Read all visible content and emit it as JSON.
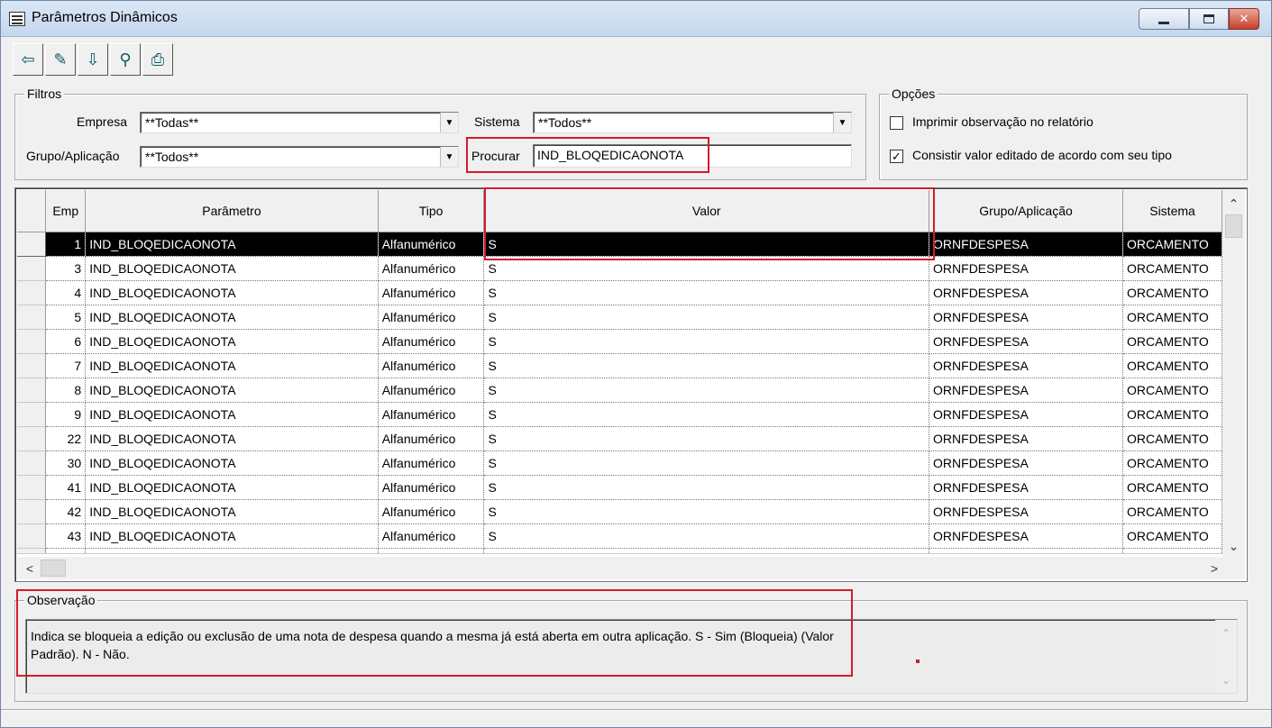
{
  "window": {
    "title": "Parâmetros Dinâmicos"
  },
  "toolbar": {
    "buttons": [
      {
        "name": "exit-icon",
        "glyph": "⇦"
      },
      {
        "name": "edit-icon",
        "glyph": "✎"
      },
      {
        "name": "import-icon",
        "glyph": "⇩"
      },
      {
        "name": "binoculars-icon",
        "glyph": "⚲"
      },
      {
        "name": "printer-icon",
        "glyph": "⎙"
      }
    ]
  },
  "filtros": {
    "legend": "Filtros",
    "empresa_label": "Empresa",
    "empresa_value": "**Todas**",
    "grupo_label": "Grupo/Aplicação",
    "grupo_value": "**Todos**",
    "sistema_label": "Sistema",
    "sistema_value": "**Todos**",
    "procurar_label": "Procurar",
    "procurar_value": "IND_BLOQEDICAONOTA"
  },
  "opcoes": {
    "legend": "Opções",
    "opt1_label": "Imprimir observação no relatório",
    "opt1_checked": false,
    "opt2_label": "Consistir valor editado de acordo com seu tipo",
    "opt2_checked": true
  },
  "grid": {
    "columns": [
      "Emp",
      "Parâmetro",
      "Tipo",
      "Valor",
      "Grupo/Aplicação",
      "Sistema"
    ],
    "selected_index": 0,
    "rows": [
      {
        "emp": "1",
        "parametro": "IND_BLOQEDICAONOTA",
        "tipo": "Alfanumérico",
        "valor": "S",
        "grupo": "ORNFDESPESA",
        "sistema": "ORCAMENTO"
      },
      {
        "emp": "3",
        "parametro": "IND_BLOQEDICAONOTA",
        "tipo": "Alfanumérico",
        "valor": "S",
        "grupo": "ORNFDESPESA",
        "sistema": "ORCAMENTO"
      },
      {
        "emp": "4",
        "parametro": "IND_BLOQEDICAONOTA",
        "tipo": "Alfanumérico",
        "valor": "S",
        "grupo": "ORNFDESPESA",
        "sistema": "ORCAMENTO"
      },
      {
        "emp": "5",
        "parametro": "IND_BLOQEDICAONOTA",
        "tipo": "Alfanumérico",
        "valor": "S",
        "grupo": "ORNFDESPESA",
        "sistema": "ORCAMENTO"
      },
      {
        "emp": "6",
        "parametro": "IND_BLOQEDICAONOTA",
        "tipo": "Alfanumérico",
        "valor": "S",
        "grupo": "ORNFDESPESA",
        "sistema": "ORCAMENTO"
      },
      {
        "emp": "7",
        "parametro": "IND_BLOQEDICAONOTA",
        "tipo": "Alfanumérico",
        "valor": "S",
        "grupo": "ORNFDESPESA",
        "sistema": "ORCAMENTO"
      },
      {
        "emp": "8",
        "parametro": "IND_BLOQEDICAONOTA",
        "tipo": "Alfanumérico",
        "valor": "S",
        "grupo": "ORNFDESPESA",
        "sistema": "ORCAMENTO"
      },
      {
        "emp": "9",
        "parametro": "IND_BLOQEDICAONOTA",
        "tipo": "Alfanumérico",
        "valor": "S",
        "grupo": "ORNFDESPESA",
        "sistema": "ORCAMENTO"
      },
      {
        "emp": "22",
        "parametro": "IND_BLOQEDICAONOTA",
        "tipo": "Alfanumérico",
        "valor": "S",
        "grupo": "ORNFDESPESA",
        "sistema": "ORCAMENTO"
      },
      {
        "emp": "30",
        "parametro": "IND_BLOQEDICAONOTA",
        "tipo": "Alfanumérico",
        "valor": "S",
        "grupo": "ORNFDESPESA",
        "sistema": "ORCAMENTO"
      },
      {
        "emp": "41",
        "parametro": "IND_BLOQEDICAONOTA",
        "tipo": "Alfanumérico",
        "valor": "S",
        "grupo": "ORNFDESPESA",
        "sistema": "ORCAMENTO"
      },
      {
        "emp": "42",
        "parametro": "IND_BLOQEDICAONOTA",
        "tipo": "Alfanumérico",
        "valor": "S",
        "grupo": "ORNFDESPESA",
        "sistema": "ORCAMENTO"
      },
      {
        "emp": "43",
        "parametro": "IND_BLOQEDICAONOTA",
        "tipo": "Alfanumérico",
        "valor": "S",
        "grupo": "ORNFDESPESA",
        "sistema": "ORCAMENTO"
      }
    ]
  },
  "observacao": {
    "legend": "Observação",
    "text": "Indica se bloqueia a edição ou exclusão de uma nota de despesa quando a mesma já está aberta em outra aplicação. S - Sim (Bloqueia) (Valor Padrão). N - Não."
  },
  "colors": {
    "highlight": "#d51a2a",
    "selected_row": "#000000"
  }
}
